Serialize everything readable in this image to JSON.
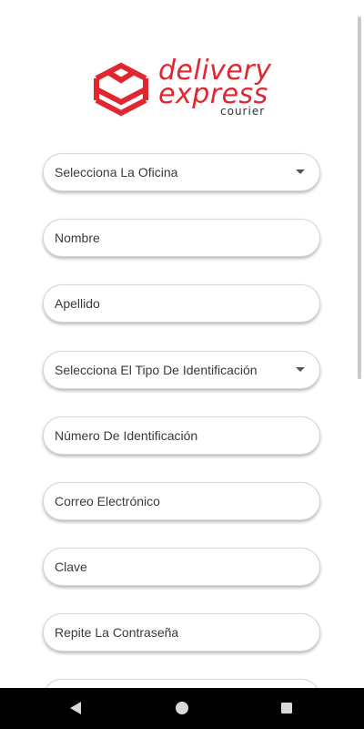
{
  "logo": {
    "line1": "delivery",
    "line2": "express",
    "line3": "courier",
    "brand_color": "#e0262f"
  },
  "form": {
    "office_select": {
      "value": "Selecciona La Oficina",
      "icon": "dropdown-arrow-icon"
    },
    "nombre": {
      "placeholder": "Nombre"
    },
    "apellido": {
      "placeholder": "Apellido"
    },
    "id_type_select": {
      "value": "Selecciona El Tipo De Identificación",
      "icon": "dropdown-arrow-icon"
    },
    "id_number": {
      "placeholder": "Número De Identificación"
    },
    "email": {
      "placeholder": "Correo Electrónico"
    },
    "password": {
      "placeholder": "Clave"
    },
    "password_repeat": {
      "placeholder": "Repite La Contraseña"
    }
  },
  "navigation_bar": {
    "back": "back-triangle-icon",
    "home": "home-circle-icon",
    "recents": "recents-square-icon"
  }
}
